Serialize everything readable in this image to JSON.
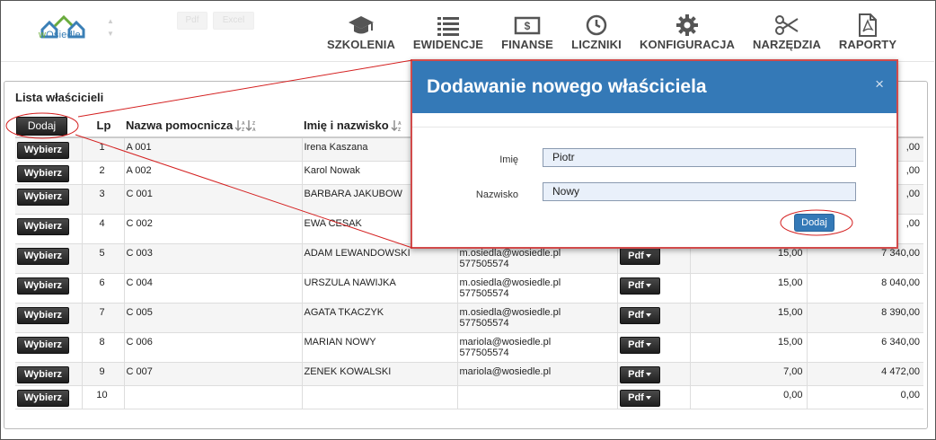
{
  "app": {
    "logo_text_w": "w",
    "logo_text_rest": "Osiedle",
    "ghost_buttons": [
      "Pdf",
      "Excel"
    ]
  },
  "nav": [
    {
      "label": "SZKOLENIA",
      "icon": "graduation-cap-icon"
    },
    {
      "label": "EWIDENCJE",
      "icon": "list-icon"
    },
    {
      "label": "FINANSE",
      "icon": "money-icon"
    },
    {
      "label": "LICZNIKI",
      "icon": "clock-icon"
    },
    {
      "label": "KONFIGURACJA",
      "icon": "gear-icon"
    },
    {
      "label": "NARZĘDZIA",
      "icon": "scissors-icon"
    },
    {
      "label": "RAPORTY",
      "icon": "pdf-file-icon"
    }
  ],
  "list": {
    "title": "Lista właścicieli",
    "add_label": "Dodaj",
    "select_label": "Wybierz",
    "pdf_label": "Pdf",
    "columns": [
      "Lp",
      "Nazwa pomocnicza",
      "Imię i nazwisko"
    ],
    "rows": [
      {
        "lp": "1",
        "name": "A 001",
        "person": "Irena Kaszana",
        "email": "",
        "phone": "",
        "pdf": false,
        "rate": "",
        "amount": ",00"
      },
      {
        "lp": "2",
        "name": "A 002",
        "person": "Karol Nowak",
        "email": "",
        "phone": "",
        "pdf": false,
        "rate": "",
        "amount": ",00"
      },
      {
        "lp": "3",
        "name": "C 001",
        "person": "BARBARA JAKUBOW",
        "email": "",
        "phone": "",
        "pdf": false,
        "rate": "",
        "amount": ",00"
      },
      {
        "lp": "4",
        "name": "C 002",
        "person": "EWA CESAK",
        "email": "",
        "phone": "",
        "pdf": false,
        "rate": "",
        "amount": ",00"
      },
      {
        "lp": "5",
        "name": "C 003",
        "person": "ADAM LEWANDOWSKI",
        "email": "m.osiedla@wosiedle.pl",
        "phone": "577505574",
        "pdf": true,
        "rate": "15,00",
        "amount": "7 340,00"
      },
      {
        "lp": "6",
        "name": "C 004",
        "person": "URSZULA NAWIJKA",
        "email": "m.osiedla@wosiedle.pl",
        "phone": "577505574",
        "pdf": true,
        "rate": "15,00",
        "amount": "8 040,00"
      },
      {
        "lp": "7",
        "name": "C 005",
        "person": "AGATA TKACZYK",
        "email": "m.osiedla@wosiedle.pl",
        "phone": "577505574",
        "pdf": true,
        "rate": "15,00",
        "amount": "8 390,00"
      },
      {
        "lp": "8",
        "name": "C 006",
        "person": "MARIAN NOWY",
        "email": "mariola@wosiedle.pl",
        "phone": "577505574",
        "pdf": true,
        "rate": "15,00",
        "amount": "6 340,00"
      },
      {
        "lp": "9",
        "name": "C 007",
        "person": "ZENEK KOWALSKI",
        "email": "mariola@wosiedle.pl",
        "phone": "",
        "pdf": true,
        "rate": "7,00",
        "amount": "4 472,00"
      },
      {
        "lp": "10",
        "name": "",
        "person": "",
        "email": "",
        "phone": "",
        "pdf": true,
        "rate": "0,00",
        "amount": "0,00"
      }
    ]
  },
  "modal": {
    "title": "Dodawanie nowego właściciela",
    "close": "×",
    "first_name_label": "Imię",
    "first_name_value": "Piotr",
    "last_name_label": "Nazwisko",
    "last_name_value": "Nowy",
    "submit_label": "Dodaj"
  },
  "colors": {
    "modal_header": "#3479b7",
    "annotation": "#d42020"
  }
}
